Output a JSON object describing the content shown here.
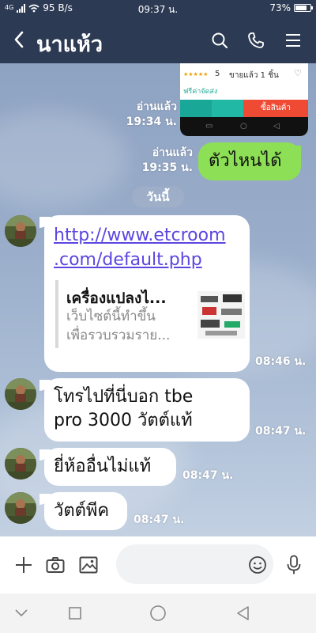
{
  "status_bar": {
    "network": "4G",
    "speed": "95 B/s",
    "time": "09:37 น.",
    "battery": "73%"
  },
  "header": {
    "title": "นาแห้ว",
    "back_icon": "chevron-left-icon",
    "actions": [
      "search-icon",
      "phone-icon",
      "menu-icon"
    ]
  },
  "messages": {
    "shared_product": {
      "rating": "5",
      "sold": "ขายแล้ว 1 ชิ้น",
      "shipping": "ฟรีค่าจัดส่ง",
      "buy_label": "ซื้อสินค้า",
      "read_status": "อ่านแล้ว",
      "time": "19:34 น."
    },
    "sent_1": {
      "text": "ตัวไหนได้",
      "read_status": "อ่านแล้ว",
      "time": "19:35 น."
    },
    "date_separator": "วันนี้",
    "recv_link": {
      "url_line1": "http://www.etcroom",
      "url_line2": ".com/default.php",
      "preview_title": "เครื่องแปลงไ...",
      "preview_desc_line1": "เว็บไซต์นี้ทำขึ้น",
      "preview_desc_line2": "เพื่อรวบรวมราย...",
      "time": "08:46 น."
    },
    "recv_2": {
      "line1": "โทรไปที่นี่บอก tbe",
      "line2": "pro 3000 วัตต์แท้",
      "time": "08:47 น."
    },
    "recv_3": {
      "text": "ยี่ห้ออื่นไม่แท้",
      "time": "08:47 น."
    },
    "recv_4": {
      "text": "วัตต์พีค",
      "time": "08:47 น."
    }
  },
  "input_bar": {
    "icons": [
      "plus-icon",
      "camera-icon",
      "image-icon",
      "emoji-icon",
      "mic-icon"
    ]
  },
  "colors": {
    "header_bg": "#2c3a53",
    "sent_bubble": "#8de055",
    "link": "#5b46e0"
  }
}
